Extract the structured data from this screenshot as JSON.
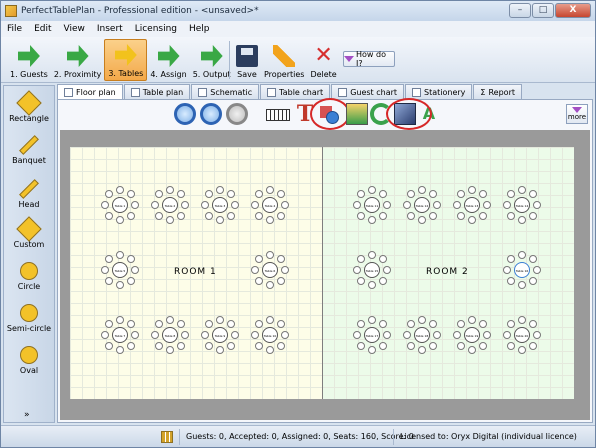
{
  "window": {
    "title": "PerfectTablePlan - Professional edition - <unsaved>*",
    "controls": [
      "–",
      "□",
      "X"
    ]
  },
  "menu": [
    "File",
    "Edit",
    "View",
    "Insert",
    "Licensing",
    "Help"
  ],
  "toolbar": {
    "steps": [
      {
        "label": "1. Guests",
        "icon": "arrow-icon"
      },
      {
        "label": "2. Proximity",
        "icon": "heart-arrow-icon"
      },
      {
        "label": "3. Tables",
        "icon": "table-arrow-icon",
        "active": true
      },
      {
        "label": "4. Assign",
        "icon": "assign-arrow-icon"
      },
      {
        "label": "5. Output",
        "icon": "output-arrow-icon"
      }
    ],
    "save_label": "Save",
    "properties_label": "Properties",
    "delete_label": "Delete",
    "howdo_label": "How do I?"
  },
  "palette": {
    "items": [
      {
        "label": "Rectangle",
        "shape": "rect"
      },
      {
        "label": "Banquet",
        "shape": "bar"
      },
      {
        "label": "Head",
        "shape": "bar"
      },
      {
        "label": "Custom",
        "shape": "rect"
      },
      {
        "label": "Circle",
        "shape": "round"
      },
      {
        "label": "Semi-circle",
        "shape": "round"
      },
      {
        "label": "Oval",
        "shape": "round"
      }
    ],
    "more_glyph": "»"
  },
  "tabs": [
    {
      "label": "Floor plan",
      "active": true
    },
    {
      "label": "Table plan"
    },
    {
      "label": "Schematic"
    },
    {
      "label": "Table chart"
    },
    {
      "label": "Guest chart"
    },
    {
      "label": "Stationery"
    },
    {
      "label": "Report"
    }
  ],
  "content_toolbar": {
    "more_label": "more"
  },
  "floorplan": {
    "rooms": [
      {
        "label": "ROOM 1"
      },
      {
        "label": "ROOM 2"
      }
    ],
    "table_label_prefix": "Table "
  },
  "status": {
    "summary": "Guests: 0, Accepted: 0, Assigned: 0, Seats: 160, Score: 0",
    "license": "Licensed to: Oryx Digital (individual licence)"
  },
  "colors": {
    "active_step": "#f3a94a",
    "room1_bg": "#fdfde8",
    "room2_bg": "#ecfbe9",
    "highlight_circle": "#d62828"
  }
}
